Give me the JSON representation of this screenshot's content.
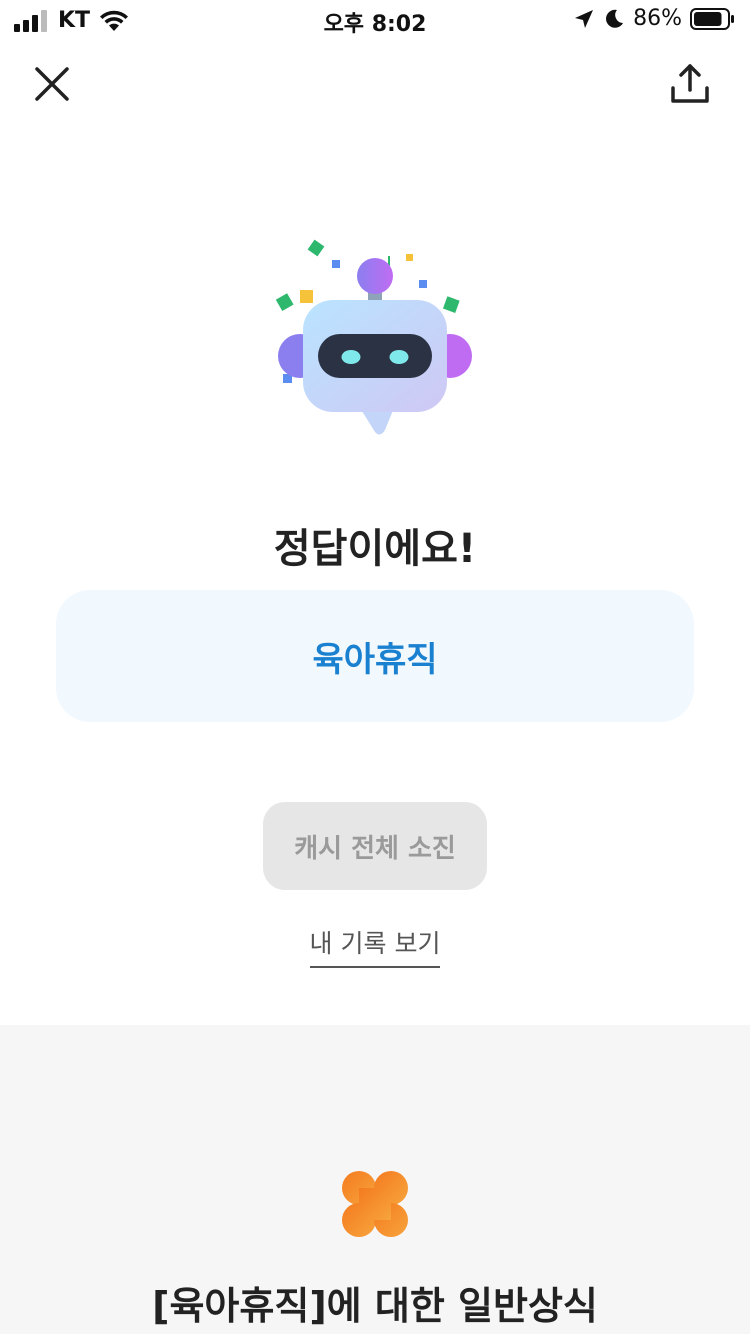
{
  "status_bar": {
    "carrier": "KT",
    "time": "오후 8:02",
    "battery_percent": "86%",
    "battery_level": 0.86
  },
  "nav": {
    "close_icon": "close-icon",
    "share_icon": "share-icon"
  },
  "result": {
    "title": "정답이에요!",
    "answer": "육아휴직"
  },
  "actions": {
    "cash_button_label": "캐시 전체 소진",
    "history_link_label": "내 기록 보기"
  },
  "info": {
    "title": "[육아휴직]에 대한 일반상식"
  },
  "colors": {
    "answer_text": "#1a80d0",
    "answer_bg": "#f1f8fe",
    "clover": "#f47b20"
  }
}
